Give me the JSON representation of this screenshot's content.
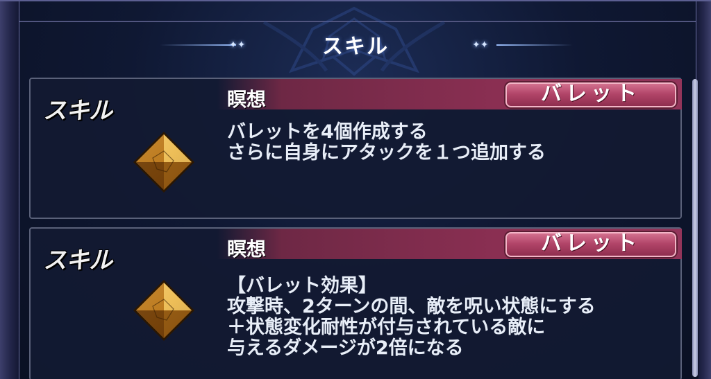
{
  "header": {
    "title": "スキル"
  },
  "skills": [
    {
      "tag": "スキル",
      "icon": "amber-diamond-gem-icon",
      "name": "瞑想",
      "type_badge": "バレット",
      "description": [
        "バレットを4個作成する",
        "さらに自身にアタックを１つ追加する"
      ]
    },
    {
      "tag": "スキル",
      "icon": "amber-diamond-gem-icon",
      "name": "瞑想",
      "type_badge": "バレット",
      "description": [
        "【バレット効果】",
        "攻撃時、2ターンの間、敵を呪い状態にする",
        "＋状態変化耐性が付与されている敵に",
        "与えるダメージが2倍になる"
      ]
    }
  ],
  "colors": {
    "panel_bg": "#121a32",
    "band": "#8a2f52",
    "badge": "#b24569",
    "text": "#e8eef8",
    "frame": "#3d3f6b"
  }
}
